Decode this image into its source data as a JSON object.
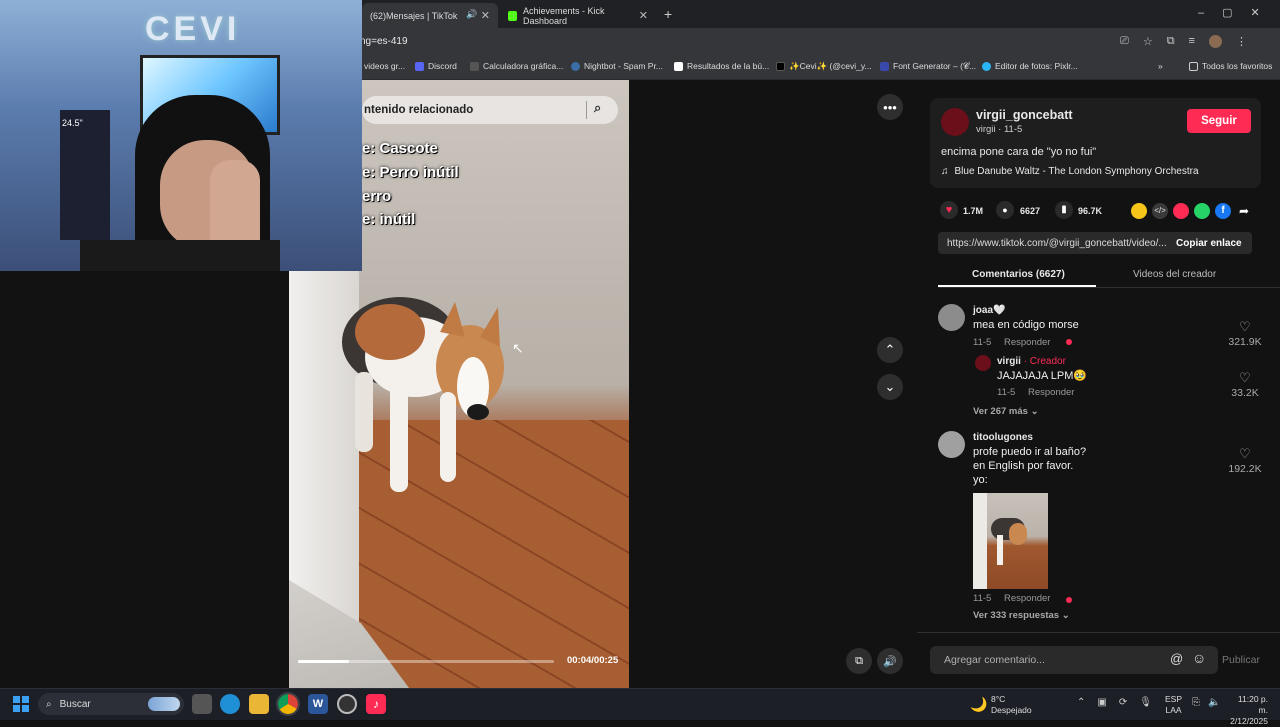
{
  "browser": {
    "tabs": [
      {
        "label": "(62)Mensajes | TikTok",
        "active": true
      },
      {
        "label": "Achievements - Kick Dashboard",
        "active": false
      }
    ],
    "new_tab": "+",
    "url": "ng=es-419",
    "bookmarks": [
      "videos gr...",
      "Discord",
      "Calculadora gráfica...",
      "Nightbot - Spam Pr...",
      "Resultados de la bú...",
      "✨Cevi✨ (@cevi_y...",
      "Font Generator – (𝓒...",
      "Editor de fotos: Pixlr..."
    ],
    "bookmarks_more": "»",
    "all_bookmarks": "Todos los favoritos"
  },
  "webcam": {
    "sign": "CEVI",
    "monitor_label": "24.5\""
  },
  "video": {
    "search_placeholder": "ntenido relacionado",
    "overlay_lines": [
      "e: Cascote",
      "e: Perro inútil",
      "erro",
      "e: inútil"
    ],
    "time": "00:04/00:25",
    "progress": 0.2
  },
  "side_controls": {
    "more": "•••",
    "up": "⌃",
    "down": "⌄"
  },
  "post": {
    "username": "virgii_goncebatt",
    "subline": "virgii · 11-5",
    "follow": "Seguir",
    "caption": "encima pone cara de \"yo no fui\"",
    "music": "Blue Danube Waltz - The London Symphony Orchestra",
    "likes": "1.7M",
    "comments": "6627",
    "saves": "96.7K",
    "link": "https://www.tiktok.com/@virgii_goncebatt/video/...",
    "copy_link": "Copiar enlace"
  },
  "tabs": {
    "comments": "Comentarios (6627)",
    "creator_videos": "Videos del creador"
  },
  "comments": [
    {
      "name": "joaa🤍",
      "text": "mea en código morse",
      "date": "11-5",
      "reply": "Responder",
      "likes": "321.9K",
      "sub": {
        "name": "virgii",
        "badge": "· Creador",
        "text": "JAJAJAJA LPM🥹",
        "date": "11-5",
        "reply": "Responder",
        "likes": "33.2K"
      },
      "more": "Ver 267 más"
    },
    {
      "name": "titoolugones",
      "text_lines": [
        "profe puedo ir al baño?",
        "en English por favor.",
        "yo:"
      ],
      "date": "11-5",
      "reply": "Responder",
      "likes": "192.2K",
      "more": "Ver 333 respuestas"
    }
  ],
  "comment_input": {
    "placeholder": "Agregar comentario...",
    "at": "@",
    "emoji": "☺",
    "publish": "Publicar"
  },
  "taskbar": {
    "search": "Buscar",
    "weather_temp": "8°C",
    "weather_text": "Despejado",
    "lang1": "ESP",
    "lang2": "LAA",
    "time": "11:20 p. m.",
    "date": "2/12/2025"
  },
  "colors": {
    "accent": "#fe2c55",
    "bg": "#121212",
    "panel": "#1e1e1e"
  }
}
